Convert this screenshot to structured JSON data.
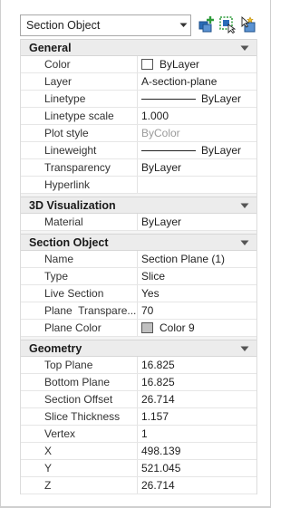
{
  "toolbar": {
    "selector_value": "Section Object",
    "icons": [
      "quick-select-icon",
      "select-objects-icon",
      "toggle-pickadd-icon"
    ]
  },
  "colors": {
    "header_bg": "#ececec",
    "accent_green": "#2e9b3a",
    "accent_blue": "#2a6cb8"
  },
  "sections": {
    "general": {
      "title": "General",
      "rows": {
        "color": {
          "label": "Color",
          "value": "ByLayer",
          "swatch": "#ffffff"
        },
        "layer": {
          "label": "Layer",
          "value": "A-section-plane"
        },
        "linetype": {
          "label": "Linetype",
          "value": "ByLayer"
        },
        "linetype_scale": {
          "label": "Linetype scale",
          "value": "1.000"
        },
        "plot_style": {
          "label": "Plot style",
          "value": "ByColor"
        },
        "lineweight": {
          "label": "Lineweight",
          "value": "ByLayer"
        },
        "transparency": {
          "label": "Transparency",
          "value": "ByLayer"
        },
        "hyperlink": {
          "label": "Hyperlink",
          "value": ""
        }
      }
    },
    "viz3d": {
      "title": "3D Visualization",
      "rows": {
        "material": {
          "label": "Material",
          "value": "ByLayer"
        }
      }
    },
    "section_object": {
      "title": "Section Object",
      "rows": {
        "name": {
          "label": "Name",
          "value": "Section Plane (1)"
        },
        "type": {
          "label": "Type",
          "value": "Slice"
        },
        "live_section": {
          "label": "Live Section",
          "value": "Yes"
        },
        "plane_transparency": {
          "label": "Plane  Transpare...",
          "value": "70"
        },
        "plane_color": {
          "label": "Plane Color",
          "value": "Color 9",
          "swatch": "#c0c0c0"
        }
      }
    },
    "geometry": {
      "title": "Geometry",
      "rows": {
        "top_plane": {
          "label": "Top Plane",
          "value": "16.825"
        },
        "bottom_plane": {
          "label": "Bottom Plane",
          "value": "16.825"
        },
        "section_offset": {
          "label": "Section Offset",
          "value": "26.714"
        },
        "slice_thickness": {
          "label": "Slice Thickness",
          "value": "1.157"
        },
        "vertex": {
          "label": "Vertex",
          "value": "1"
        },
        "x": {
          "label": "X",
          "value": "498.139"
        },
        "y": {
          "label": "Y",
          "value": "521.045"
        },
        "z": {
          "label": "Z",
          "value": "26.714"
        }
      }
    }
  }
}
